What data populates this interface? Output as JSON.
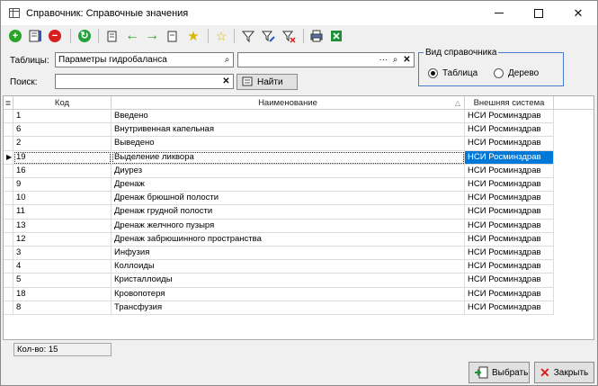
{
  "window": {
    "title": "Справочник: Справочные значения"
  },
  "filters": {
    "tables_label": "Таблицы:",
    "tables_value": "Параметры гидробаланса",
    "second_value": "",
    "ellipsis": "···",
    "search_label": "Поиск:",
    "search_value": "",
    "find_label": "Найти"
  },
  "view": {
    "title": "Вид справочника",
    "table": "Таблица",
    "tree": "Дерево",
    "selected": "Таблица"
  },
  "grid": {
    "columns": [
      "Код",
      "Наименование",
      "Внешняя система"
    ],
    "sort_indicator": "△",
    "selected_row_index": 3,
    "rows": [
      {
        "code": "1",
        "name": "Введено",
        "system": "НСИ Росминздрав"
      },
      {
        "code": "6",
        "name": "Внутривенная капельная",
        "system": "НСИ Росминздрав"
      },
      {
        "code": "2",
        "name": "Выведено",
        "system": "НСИ Росминздрав"
      },
      {
        "code": "19",
        "name": "Выделение ликвора",
        "system": "НСИ Росминздрав"
      },
      {
        "code": "16",
        "name": "Диурез",
        "system": "НСИ Росминздрав"
      },
      {
        "code": "9",
        "name": "Дренаж",
        "system": "НСИ Росминздрав"
      },
      {
        "code": "10",
        "name": "Дренаж брюшной полости",
        "system": "НСИ Росминздрав"
      },
      {
        "code": "11",
        "name": "Дренаж грудной полости",
        "system": "НСИ Росминздрав"
      },
      {
        "code": "13",
        "name": "Дренаж желчного пузыря",
        "system": "НСИ Росминздрав"
      },
      {
        "code": "12",
        "name": "Дренаж забрюшинного пространства",
        "system": "НСИ Росминздрав"
      },
      {
        "code": "3",
        "name": "Инфузия",
        "system": "НСИ Росминздрав"
      },
      {
        "code": "4",
        "name": "Коллоиды",
        "system": "НСИ Росминздрав"
      },
      {
        "code": "5",
        "name": "Кристаллоиды",
        "system": "НСИ Росминздрав"
      },
      {
        "code": "18",
        "name": "Кровопотеря",
        "system": "НСИ Росминздрав"
      },
      {
        "code": "8",
        "name": "Трансфузия",
        "system": "НСИ Росминздрав"
      }
    ]
  },
  "status": {
    "count_text": "Кол-во: 15"
  },
  "buttons": {
    "select": "Выбрать",
    "close": "Закрыть"
  },
  "colors": {
    "selection": "#0078d7",
    "groupbox_border": "#4a7dc9"
  }
}
